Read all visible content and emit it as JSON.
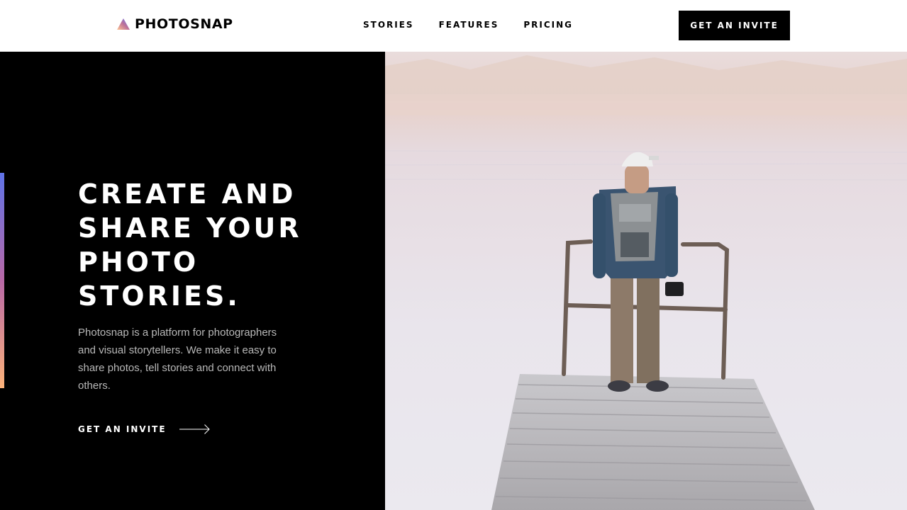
{
  "brand": {
    "name": "PHOTOSNAP",
    "logo_gradient": [
      "#ffc593",
      "#bc7198",
      "#5a77ff"
    ]
  },
  "nav": {
    "items": [
      {
        "label": "STORIES"
      },
      {
        "label": "FEATURES"
      },
      {
        "label": "PRICING"
      }
    ],
    "cta_label": "GET AN INVITE"
  },
  "hero": {
    "title_lines": [
      "CREATE AND",
      "SHARE YOUR",
      "PHOTO",
      "STORIES."
    ],
    "description": "Photosnap is a platform for photographers and visual storytellers. We make it easy to share photos, tell stories and connect with others.",
    "cta_label": "GET AN INVITE",
    "cta_icon": "arrow-right-icon",
    "accent_gradient": [
      "#5f73e8",
      "#b868a6",
      "#fdb37a"
    ]
  },
  "colors": {
    "header_bg": "#ffffff",
    "hero_bg": "#000000",
    "text_light": "#ffffff",
    "text_muted": "#b8b8b8"
  }
}
